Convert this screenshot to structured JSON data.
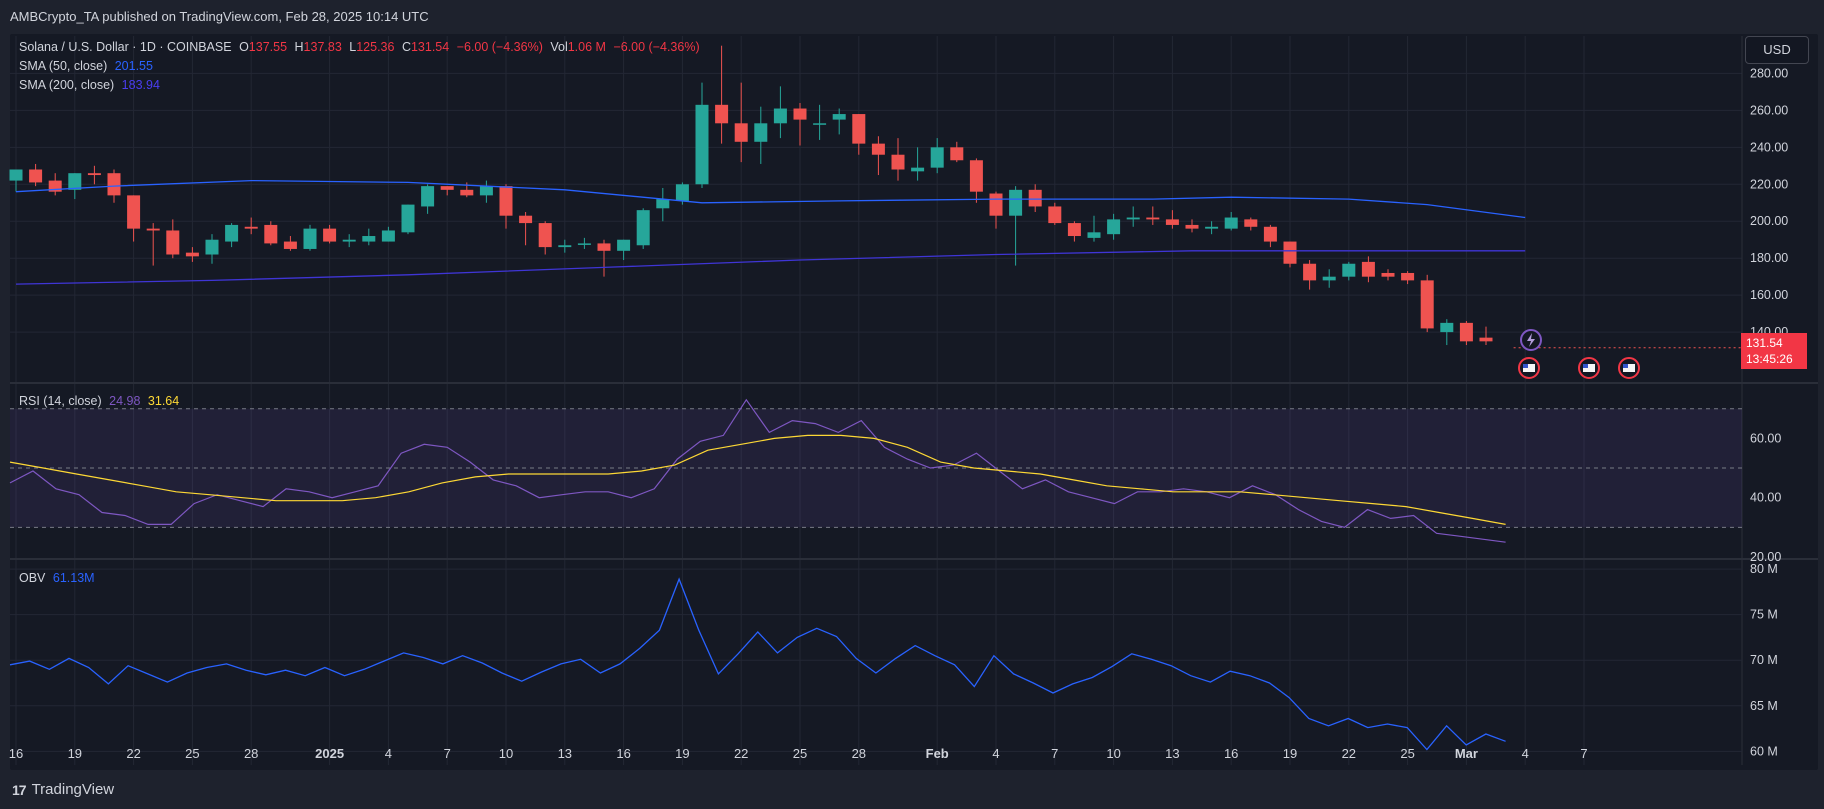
{
  "header": {
    "published": "AMBCrypto_TA published on TradingView.com, Feb 28, 2025 10:14 UTC"
  },
  "symbol": {
    "name": "Solana / U.S. Dollar · 1D · COINBASE",
    "o_label": "O",
    "o": "137.55",
    "h_label": "H",
    "h": "137.83",
    "l_label": "L",
    "l": "125.36",
    "c_label": "C",
    "c": "131.54",
    "change": "−6.00 (−4.36%)",
    "vol_label": "Vol",
    "vol": "1.06 M",
    "vol_change": "−6.00 (−4.36%)"
  },
  "indicators": {
    "sma50_label": "SMA (50, close)",
    "sma50_value": "201.55",
    "sma200_label": "SMA (200, close)",
    "sma200_value": "183.94",
    "rsi_label": "RSI (14, close)",
    "rsi_value": "24.98",
    "rsi_ma_value": "31.64",
    "obv_label": "OBV",
    "obv_value": "61.13M"
  },
  "currency_button": "USD",
  "last_price": {
    "price": "131.54",
    "countdown": "13:45:26"
  },
  "footer": {
    "brand": "TradingView",
    "logo_glyph": "17"
  },
  "colors": {
    "up": "#26a69a",
    "down": "#ef5350",
    "sma50": "#2962ff",
    "sma200": "#3f35d6",
    "rsi": "#7e57c2",
    "rsi_ma": "#fdd835",
    "obv": "#2962ff",
    "background": "#151924"
  },
  "chart_data": [
    {
      "type": "candlestick",
      "title": "Solana / U.S. Dollar · 1D · COINBASE",
      "price_axis_ticks": [
        "280.00",
        "260.00",
        "240.00",
        "220.00",
        "200.00",
        "180.00",
        "160.00",
        "140.00"
      ],
      "ylim": [
        113,
        297
      ],
      "x_tick_labels": [
        "16",
        "19",
        "22",
        "25",
        "28",
        "2025",
        "4",
        "7",
        "10",
        "13",
        "16",
        "19",
        "22",
        "25",
        "28",
        "Feb",
        "4",
        "7",
        "10",
        "13",
        "16",
        "19",
        "22",
        "25",
        "Mar",
        "4",
        "7"
      ],
      "x_tick_days": [
        0,
        3,
        6,
        9,
        12,
        16,
        19,
        22,
        25,
        28,
        31,
        34,
        37,
        40,
        43,
        47,
        50,
        53,
        56,
        59,
        62,
        65,
        68,
        71,
        74,
        77,
        80
      ],
      "candles": [
        {
          "o": 222,
          "h": 227,
          "l": 216,
          "c": 228
        },
        {
          "o": 228,
          "h": 231,
          "l": 219,
          "c": 221
        },
        {
          "o": 222,
          "h": 226,
          "l": 214,
          "c": 216
        },
        {
          "o": 217,
          "h": 222,
          "l": 212,
          "c": 226
        },
        {
          "o": 226,
          "h": 230,
          "l": 220,
          "c": 225
        },
        {
          "o": 226,
          "h": 228,
          "l": 210,
          "c": 214
        },
        {
          "o": 214,
          "h": 213,
          "l": 189,
          "c": 196
        },
        {
          "o": 196,
          "h": 199,
          "l": 176,
          "c": 195
        },
        {
          "o": 195,
          "h": 201,
          "l": 180,
          "c": 182
        },
        {
          "o": 183,
          "h": 186,
          "l": 178,
          "c": 181
        },
        {
          "o": 182,
          "h": 193,
          "l": 177,
          "c": 190
        },
        {
          "o": 189,
          "h": 199,
          "l": 186,
          "c": 198
        },
        {
          "o": 197,
          "h": 202,
          "l": 193,
          "c": 196
        },
        {
          "o": 198,
          "h": 200,
          "l": 187,
          "c": 188
        },
        {
          "o": 189,
          "h": 192,
          "l": 184,
          "c": 185
        },
        {
          "o": 185,
          "h": 198,
          "l": 184,
          "c": 196
        },
        {
          "o": 196,
          "h": 198,
          "l": 188,
          "c": 189
        },
        {
          "o": 189,
          "h": 193,
          "l": 186,
          "c": 190
        },
        {
          "o": 189,
          "h": 196,
          "l": 187,
          "c": 192
        },
        {
          "o": 189,
          "h": 197,
          "l": 189,
          "c": 195
        },
        {
          "o": 194,
          "h": 208,
          "l": 193,
          "c": 209
        },
        {
          "o": 208,
          "h": 220,
          "l": 204,
          "c": 219
        },
        {
          "o": 219,
          "h": 219,
          "l": 214,
          "c": 217
        },
        {
          "o": 217,
          "h": 221,
          "l": 213,
          "c": 214
        },
        {
          "o": 214,
          "h": 222,
          "l": 210,
          "c": 219
        },
        {
          "o": 219,
          "h": 220,
          "l": 196,
          "c": 203
        },
        {
          "o": 203,
          "h": 205,
          "l": 187,
          "c": 199
        },
        {
          "o": 199,
          "h": 200,
          "l": 182,
          "c": 186
        },
        {
          "o": 186,
          "h": 190,
          "l": 183,
          "c": 187
        },
        {
          "o": 188,
          "h": 191,
          "l": 185,
          "c": 188
        },
        {
          "o": 188,
          "h": 190,
          "l": 170,
          "c": 184
        },
        {
          "o": 184,
          "h": 188,
          "l": 179,
          "c": 190
        },
        {
          "o": 187,
          "h": 207,
          "l": 185,
          "c": 206
        },
        {
          "o": 207,
          "h": 218,
          "l": 200,
          "c": 212
        },
        {
          "o": 211,
          "h": 221,
          "l": 209,
          "c": 220
        },
        {
          "o": 220,
          "h": 275,
          "l": 218,
          "c": 263
        },
        {
          "o": 263,
          "h": 295,
          "l": 242,
          "c": 253
        },
        {
          "o": 253,
          "h": 275,
          "l": 232,
          "c": 243
        },
        {
          "o": 243,
          "h": 262,
          "l": 231,
          "c": 253
        },
        {
          "o": 253,
          "h": 273,
          "l": 245,
          "c": 261
        },
        {
          "o": 261,
          "h": 264,
          "l": 241,
          "c": 255
        },
        {
          "o": 253,
          "h": 263,
          "l": 244,
          "c": 253
        },
        {
          "o": 255,
          "h": 261,
          "l": 247,
          "c": 258
        },
        {
          "o": 258,
          "h": 258,
          "l": 236,
          "c": 242
        },
        {
          "o": 242,
          "h": 246,
          "l": 225,
          "c": 236
        },
        {
          "o": 236,
          "h": 245,
          "l": 222,
          "c": 228
        },
        {
          "o": 227,
          "h": 240,
          "l": 222,
          "c": 229
        },
        {
          "o": 229,
          "h": 245,
          "l": 226,
          "c": 240
        },
        {
          "o": 240,
          "h": 243,
          "l": 232,
          "c": 233
        },
        {
          "o": 233,
          "h": 234,
          "l": 210,
          "c": 216
        },
        {
          "o": 215,
          "h": 216,
          "l": 196,
          "c": 203
        },
        {
          "o": 203,
          "h": 219,
          "l": 176,
          "c": 217
        },
        {
          "o": 217,
          "h": 220,
          "l": 205,
          "c": 208
        },
        {
          "o": 208,
          "h": 210,
          "l": 198,
          "c": 199
        },
        {
          "o": 199,
          "h": 200,
          "l": 189,
          "c": 192
        },
        {
          "o": 191,
          "h": 203,
          "l": 189,
          "c": 194
        },
        {
          "o": 193,
          "h": 204,
          "l": 190,
          "c": 201
        },
        {
          "o": 201,
          "h": 208,
          "l": 197,
          "c": 202
        },
        {
          "o": 202,
          "h": 208,
          "l": 198,
          "c": 201
        },
        {
          "o": 201,
          "h": 206,
          "l": 196,
          "c": 198
        },
        {
          "o": 198,
          "h": 201,
          "l": 194,
          "c": 196
        },
        {
          "o": 196,
          "h": 200,
          "l": 193,
          "c": 197
        },
        {
          "o": 196,
          "h": 205,
          "l": 195,
          "c": 202
        },
        {
          "o": 201,
          "h": 202,
          "l": 195,
          "c": 197
        },
        {
          "o": 197,
          "h": 198,
          "l": 186,
          "c": 189
        },
        {
          "o": 189,
          "h": 187,
          "l": 175,
          "c": 177
        },
        {
          "o": 177,
          "h": 179,
          "l": 163,
          "c": 168
        },
        {
          "o": 168,
          "h": 174,
          "l": 164,
          "c": 170
        },
        {
          "o": 170,
          "h": 178,
          "l": 168,
          "c": 177
        },
        {
          "o": 178,
          "h": 181,
          "l": 167,
          "c": 170
        },
        {
          "o": 172,
          "h": 174,
          "l": 168,
          "c": 170
        },
        {
          "o": 172,
          "h": 173,
          "l": 166,
          "c": 168
        },
        {
          "o": 168,
          "h": 171,
          "l": 140,
          "c": 142
        },
        {
          "o": 140,
          "h": 147,
          "l": 133,
          "c": 145
        },
        {
          "o": 145,
          "h": 146,
          "l": 133,
          "c": 135
        },
        {
          "o": 137,
          "h": 143,
          "l": 133,
          "c": 135
        }
      ],
      "sma50": [
        {
          "d": 0,
          "v": 216
        },
        {
          "d": 5,
          "v": 219
        },
        {
          "d": 12,
          "v": 222
        },
        {
          "d": 20,
          "v": 221
        },
        {
          "d": 28,
          "v": 217
        },
        {
          "d": 35,
          "v": 210
        },
        {
          "d": 42,
          "v": 211
        },
        {
          "d": 50,
          "v": 212
        },
        {
          "d": 58,
          "v": 212
        },
        {
          "d": 62,
          "v": 213
        },
        {
          "d": 68,
          "v": 212
        },
        {
          "d": 72,
          "v": 209
        },
        {
          "d": 77,
          "v": 202
        }
      ],
      "sma200": [
        {
          "d": 0,
          "v": 166
        },
        {
          "d": 10,
          "v": 168
        },
        {
          "d": 20,
          "v": 171
        },
        {
          "d": 30,
          "v": 175
        },
        {
          "d": 40,
          "v": 179
        },
        {
          "d": 50,
          "v": 182
        },
        {
          "d": 60,
          "v": 184
        },
        {
          "d": 70,
          "v": 184
        },
        {
          "d": 77,
          "v": 184
        }
      ]
    },
    {
      "type": "line",
      "title": "RSI (14, close)",
      "ylim": [
        20,
        78
      ],
      "axis_ticks": [
        "60.00",
        "40.00",
        "20.00"
      ],
      "bands": [
        30,
        50,
        70
      ],
      "series": [
        {
          "name": "RSI",
          "values": [
            45,
            49,
            43,
            41,
            35,
            34,
            31,
            31,
            38,
            41,
            39,
            37,
            43,
            42,
            40,
            42,
            44,
            55,
            58,
            57,
            52,
            46,
            44,
            40,
            41,
            42,
            42,
            40,
            43,
            53,
            59,
            61,
            73,
            62,
            66,
            65,
            62,
            66,
            57,
            53,
            50,
            51,
            55,
            49,
            43,
            46,
            42,
            40,
            38,
            42,
            42,
            43,
            42,
            40,
            44,
            41,
            36,
            32,
            30,
            36,
            33,
            34,
            28,
            27,
            26,
            25
          ]
        },
        {
          "name": "RSI-based MA",
          "values": [
            52,
            50,
            48,
            46,
            44,
            42,
            41,
            40,
            39,
            39,
            39,
            40,
            42,
            45,
            47,
            48,
            48,
            48,
            48,
            49,
            51,
            56,
            58,
            60,
            61,
            61,
            60,
            57,
            52,
            50,
            49,
            48,
            46,
            44,
            43,
            42,
            42,
            42,
            41,
            40,
            39,
            38,
            37,
            35,
            33,
            31
          ]
        }
      ]
    },
    {
      "type": "line",
      "title": "OBV",
      "ylim": [
        58.5,
        81
      ],
      "axis_ticks": [
        "80 M",
        "75 M",
        "70 M",
        "65 M",
        "60 M"
      ],
      "series": [
        {
          "name": "OBV",
          "values": [
            69.5,
            69.9,
            69.0,
            70.2,
            69.2,
            67.4,
            69.4,
            68.5,
            67.6,
            68.6,
            69.2,
            69.6,
            68.9,
            68.4,
            68.9,
            68.3,
            69.2,
            68.3,
            69.0,
            69.9,
            70.8,
            70.3,
            69.6,
            70.5,
            69.7,
            68.6,
            67.7,
            68.7,
            69.6,
            70.1,
            68.6,
            69.6,
            71.3,
            73.3,
            78.9,
            73.3,
            68.5,
            70.7,
            73.1,
            70.8,
            72.5,
            73.5,
            72.6,
            70.2,
            68.6,
            70.2,
            71.6,
            70.5,
            69.5,
            67.1,
            70.5,
            68.5,
            67.5,
            66.4,
            67.4,
            68.1,
            69.3,
            70.7,
            70.1,
            69.4,
            68.3,
            67.6,
            68.8,
            68.3,
            67.5,
            65.9,
            63.6,
            62.8,
            63.6,
            62.6,
            63.0,
            62.6,
            60.2,
            62.8,
            60.7,
            61.9,
            61.1
          ]
        }
      ]
    }
  ]
}
